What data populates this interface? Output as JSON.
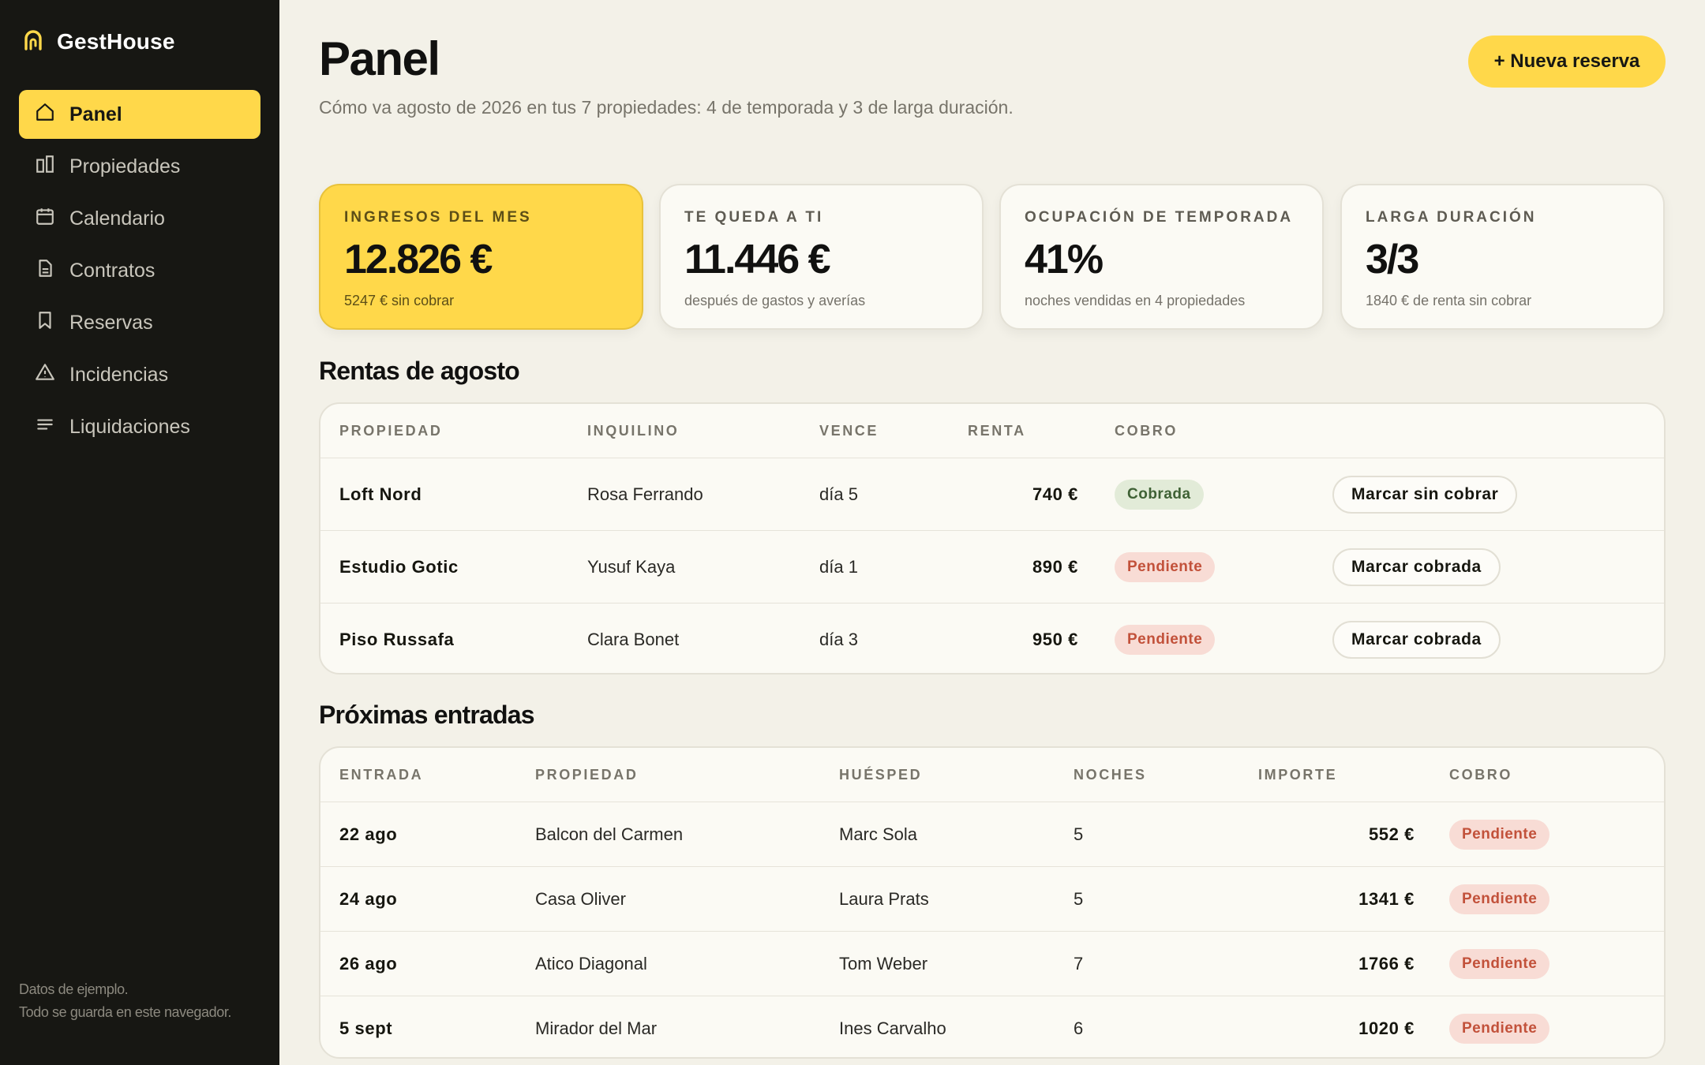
{
  "brand": {
    "name": "GestHouse"
  },
  "nav": [
    {
      "label": "Panel",
      "icon": "home-icon",
      "active": true
    },
    {
      "label": "Propiedades",
      "icon": "buildings-icon"
    },
    {
      "label": "Calendario",
      "icon": "calendar-icon"
    },
    {
      "label": "Contratos",
      "icon": "document-icon"
    },
    {
      "label": "Reservas",
      "icon": "bookmark-icon"
    },
    {
      "label": "Incidencias",
      "icon": "warning-icon"
    },
    {
      "label": "Liquidaciones",
      "icon": "list-icon"
    }
  ],
  "sidebar_footer": {
    "line1": "Datos de ejemplo.",
    "line2": "Todo se guarda en este navegador."
  },
  "header": {
    "title": "Panel",
    "subtitle": "Cómo va agosto de 2026 en tus 7 propiedades: 4 de temporada y 3 de larga duración.",
    "new_button": "+ Nueva reserva"
  },
  "kpis": [
    {
      "label": "INGRESOS DEL MES",
      "value": "12.826 €",
      "sub": "5247 € sin cobrar"
    },
    {
      "label": "TE QUEDA A TI",
      "value": "11.446 €",
      "sub": "después de gastos y averías"
    },
    {
      "label": "OCUPACIÓN DE TEMPORADA",
      "value": "41%",
      "sub": "noches vendidas en 4 propiedades"
    },
    {
      "label": "LARGA DURACIÓN",
      "value": "3/3",
      "sub": "1840 € de renta sin cobrar"
    }
  ],
  "rents": {
    "title": "Rentas de agosto",
    "headers": [
      "PROPIEDAD",
      "INQUILINO",
      "VENCE",
      "RENTA",
      "COBRO"
    ],
    "rows": [
      {
        "property": "Loft Nord",
        "tenant": "Rosa Ferrando",
        "due": "día 5",
        "rent": "740 €",
        "status": "Cobrada",
        "status_type": "ok",
        "action": "Marcar sin cobrar"
      },
      {
        "property": "Estudio Gotic",
        "tenant": "Yusuf Kaya",
        "due": "día 1",
        "rent": "890 €",
        "status": "Pendiente",
        "status_type": "pending",
        "action": "Marcar cobrada"
      },
      {
        "property": "Piso Russafa",
        "tenant": "Clara Bonet",
        "due": "día 3",
        "rent": "950 €",
        "status": "Pendiente",
        "status_type": "pending",
        "action": "Marcar cobrada"
      }
    ]
  },
  "arrivals": {
    "title": "Próximas entradas",
    "headers": [
      "ENTRADA",
      "PROPIEDAD",
      "HUÉSPED",
      "NOCHES",
      "IMPORTE",
      "COBRO"
    ],
    "rows": [
      {
        "date": "22 ago",
        "property": "Balcon del Carmen",
        "guest": "Marc Sola",
        "nights": "5",
        "amount": "552 €",
        "status": "Pendiente"
      },
      {
        "date": "24 ago",
        "property": "Casa Oliver",
        "guest": "Laura Prats",
        "nights": "5",
        "amount": "1341 €",
        "status": "Pendiente"
      },
      {
        "date": "26 ago",
        "property": "Atico Diagonal",
        "guest": "Tom Weber",
        "nights": "7",
        "amount": "1766 €",
        "status": "Pendiente"
      },
      {
        "date": "5 sept",
        "property": "Mirador del Mar",
        "guest": "Ines Carvalho",
        "nights": "6",
        "amount": "1020 €",
        "status": "Pendiente"
      }
    ]
  },
  "colors": {
    "accent": "#ffd84a",
    "sidebar": "#171713",
    "background": "#f3f1e8",
    "ok": "#3f6135",
    "pending": "#c2513a"
  }
}
